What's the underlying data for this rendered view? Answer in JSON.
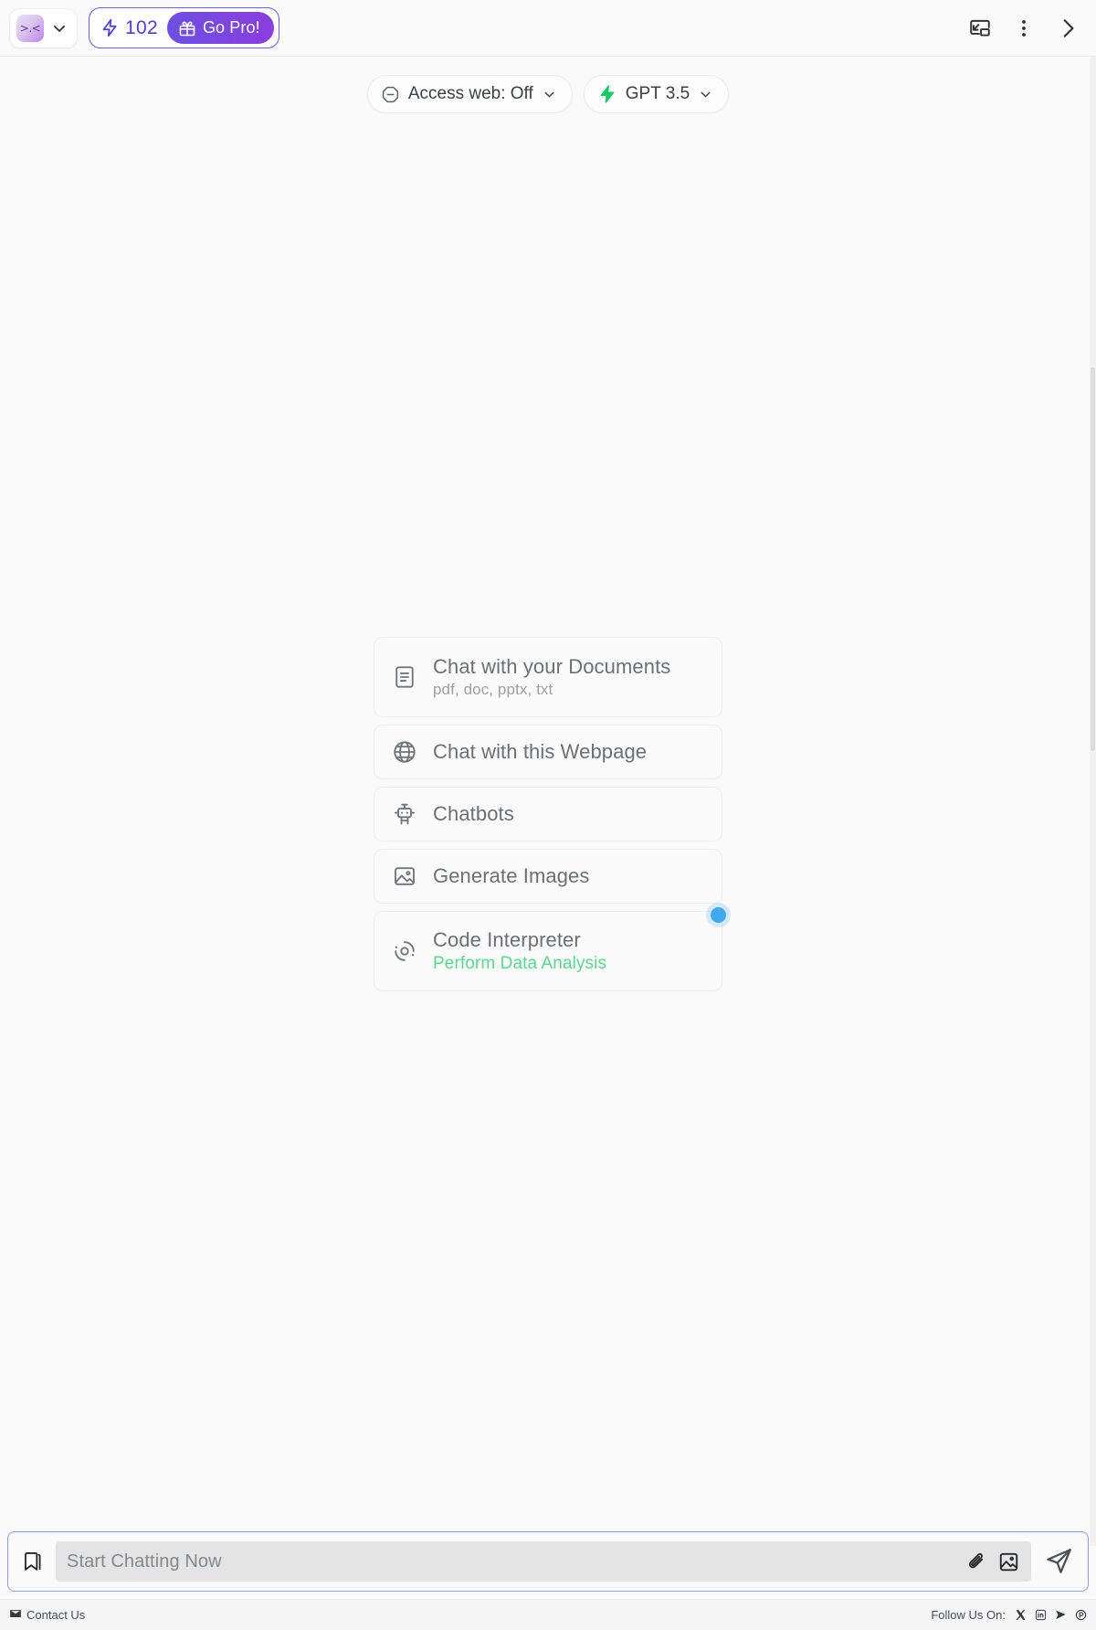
{
  "topbar": {
    "avatar_face": ">.<",
    "avatar_name": "workspace-avatar",
    "chevron_name": "chevron-down-icon",
    "credits": "102",
    "bolt_icon": "lightning-bolt-icon",
    "go_pro_label": "Go Pro!",
    "gift_icon": "gift-icon",
    "pip_icon": "picture-in-picture-icon",
    "more_icon": "more-vertical-icon",
    "collapse_icon": "chevron-right-icon"
  },
  "pills": [
    {
      "label": "Access web: Off",
      "icon": "minus-octagon-icon",
      "caret": "chevron-down-icon"
    },
    {
      "label": "GPT 3.5",
      "icon": "bolt-green-icon",
      "caret": "chevron-down-icon"
    }
  ],
  "cards": [
    {
      "title": "Chat with your Documents",
      "subtitle": "pdf, doc, pptx, txt",
      "icon": "document-icon",
      "badge": false
    },
    {
      "title": "Chat with this Webpage",
      "subtitle": "",
      "icon": "globe-icon",
      "badge": false
    },
    {
      "title": "Chatbots",
      "subtitle": "",
      "icon": "robot-icon",
      "badge": false
    },
    {
      "title": "Generate Images",
      "subtitle": "",
      "icon": "image-icon",
      "badge": false
    },
    {
      "title": "Code Interpreter",
      "subtitle": "Perform Data Analysis",
      "icon": "code-interpreter-icon",
      "badge": true
    }
  ],
  "composer": {
    "bookmark_icon": "bookmark-icon",
    "placeholder": "Start Chatting Now",
    "value": "",
    "attach_icon": "paperclip-icon",
    "image_icon": "image-icon",
    "send_icon": "send-icon"
  },
  "footer": {
    "contact_label": "Contact Us",
    "mail_icon": "envelope-icon",
    "follow_label": "Follow Us On:",
    "socials": [
      {
        "name": "x-twitter-icon"
      },
      {
        "name": "linkedin-icon"
      },
      {
        "name": "telegram-icon"
      },
      {
        "name": "product-hunt-icon"
      }
    ]
  },
  "colors": {
    "accent_purple": "#6c5ce7",
    "gopro_gradient_start": "#6d4fe0",
    "gopro_gradient_end": "#8b3de0",
    "green_accent": "#5ed68f",
    "badge_blue": "#41a9f0",
    "input_border": "#8b9cf0",
    "page_bg": "#fafafa"
  }
}
